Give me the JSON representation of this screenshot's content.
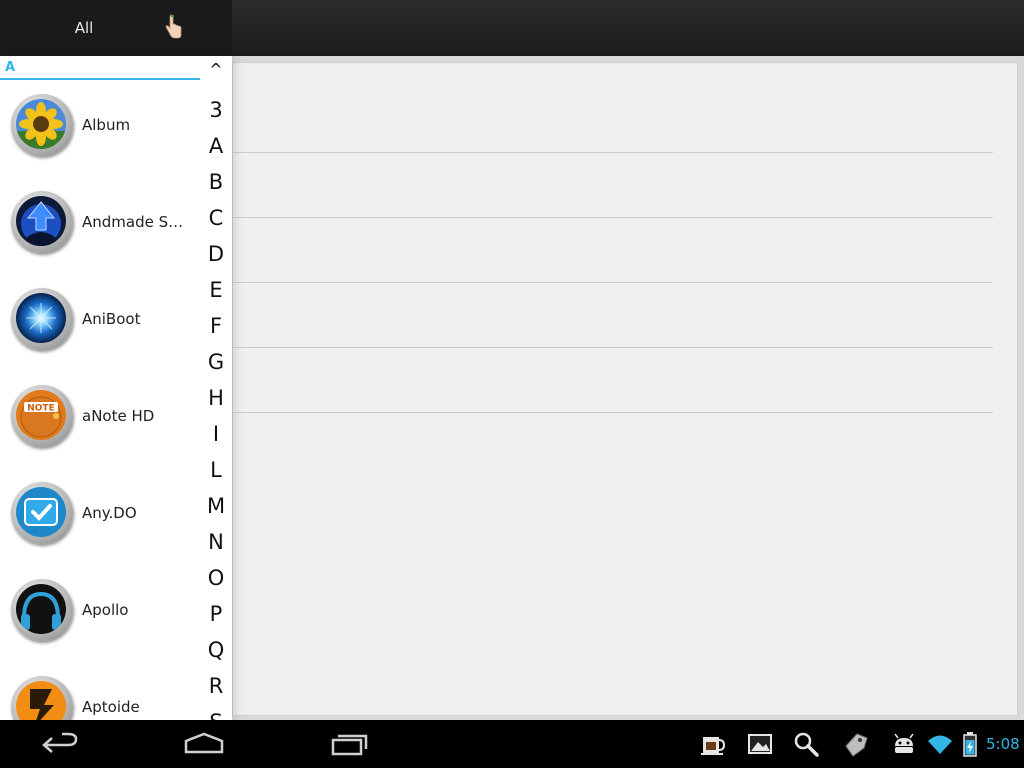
{
  "top_bar": {
    "tab_all": "All",
    "hand_icon": "pointing-hand-icon"
  },
  "drawer": {
    "section_header": "A",
    "apps": [
      {
        "name": "Album",
        "icon": "sunflower-icon"
      },
      {
        "name": "Andmade Sh…",
        "icon": "blue-arrow-up-icon"
      },
      {
        "name": "AniBoot",
        "icon": "blue-burst-icon"
      },
      {
        "name": "aNote HD",
        "icon": "note-icon"
      },
      {
        "name": "Any.DO",
        "icon": "checkmark-icon"
      },
      {
        "name": "Apollo",
        "icon": "headphones-icon"
      },
      {
        "name": "Aptoide",
        "icon": "aptoide-icon"
      }
    ]
  },
  "alpha_index": {
    "caret": "^",
    "letters": [
      "3",
      "A",
      "B",
      "C",
      "D",
      "E",
      "F",
      "G",
      "H",
      "I",
      "L",
      "M",
      "N",
      "O",
      "P",
      "Q",
      "R",
      "S"
    ]
  },
  "nav_bar": {
    "buttons": [
      "back-icon",
      "home-icon",
      "recent-apps-icon"
    ],
    "tray": [
      "coffee-cup-icon",
      "picture-icon",
      "magnifier-icon",
      "tag-icon",
      "android-icon",
      "wifi-icon",
      "battery-icon"
    ],
    "clock": "5:08"
  },
  "colors": {
    "accent": "#33b5e5",
    "drawer_bg": "#ffffff",
    "panel_bg": "#efefef",
    "nav_bg": "#000000"
  }
}
